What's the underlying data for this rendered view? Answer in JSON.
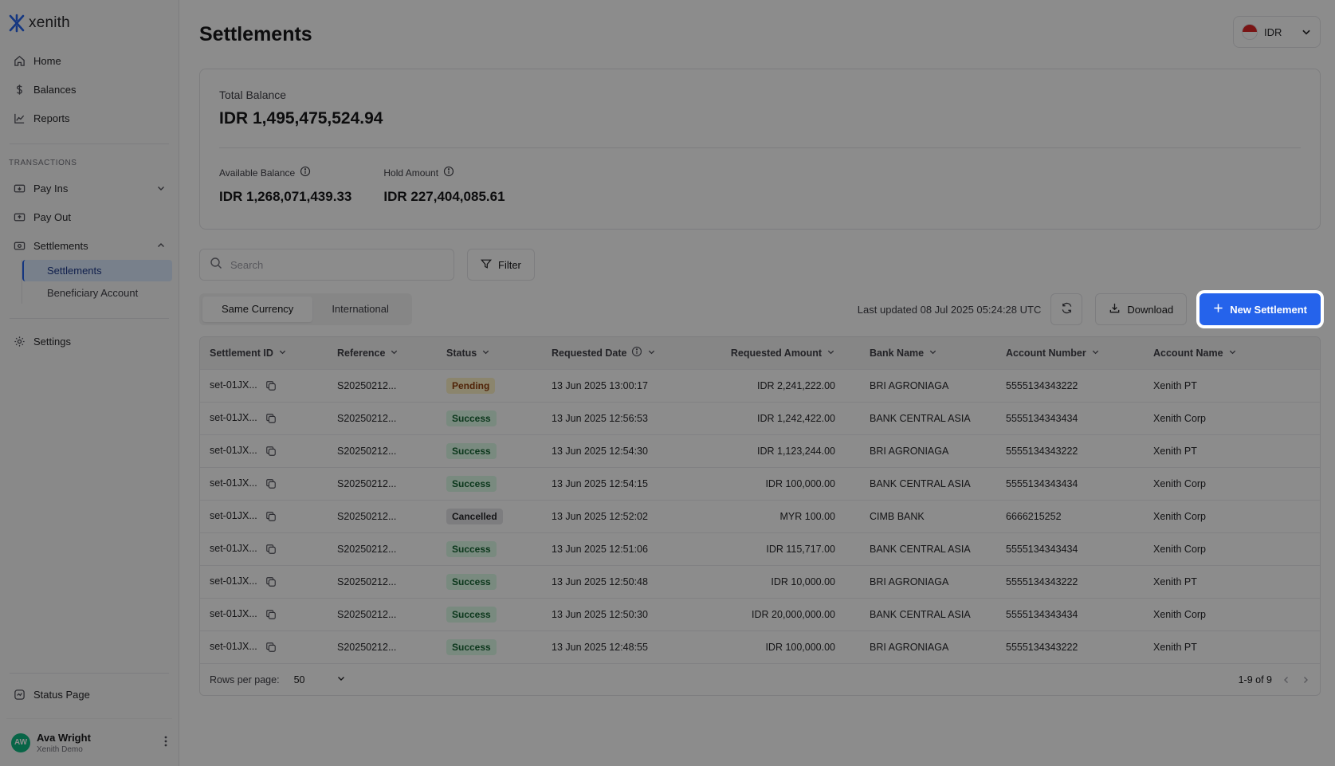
{
  "brand": {
    "name": "xenith"
  },
  "sidebar": {
    "top_items": [
      {
        "label": "Home",
        "icon": "home-icon"
      },
      {
        "label": "Balances",
        "icon": "dollar-icon"
      },
      {
        "label": "Reports",
        "icon": "chart-icon"
      }
    ],
    "section_label": "TRANSACTIONS",
    "transactions": {
      "pay_ins": "Pay Ins",
      "pay_out": "Pay Out",
      "settlements": "Settlements",
      "sub_items": [
        "Settlements",
        "Beneficiary Account"
      ]
    },
    "settings": "Settings",
    "status_page": "Status Page",
    "user": {
      "initials": "AW",
      "name": "Ava Wright",
      "org": "Xenith Demo"
    }
  },
  "header": {
    "title": "Settlements",
    "currency": "IDR"
  },
  "balances": {
    "total_label": "Total Balance",
    "total_value": "IDR 1,495,475,524.94",
    "available_label": "Available Balance",
    "available_value": "IDR 1,268,071,439.33",
    "hold_label": "Hold Amount",
    "hold_value": "IDR 227,404,085.61"
  },
  "toolbar": {
    "search_placeholder": "Search",
    "filter_label": "Filter",
    "tabs": [
      "Same Currency",
      "International"
    ],
    "last_updated": "Last updated 08 Jul 2025 05:24:28 UTC",
    "download_label": "Download",
    "new_settlement_label": "New Settlement"
  },
  "table": {
    "headers": {
      "settlement_id": "Settlement ID",
      "reference": "Reference",
      "status": "Status",
      "requested_date": "Requested Date",
      "requested_amount": "Requested Amount",
      "bank_name": "Bank Name",
      "account_number": "Account Number",
      "account_name": "Account Name"
    },
    "rows": [
      {
        "id": "set-01JX...",
        "ref": "S20250212...",
        "status": "Pending",
        "date": "13 Jun 2025 13:00:17",
        "amount": "IDR 2,241,222.00",
        "bank": "BRI AGRONIAGA",
        "acct_no": "5555134343222",
        "acct_name": "Xenith PT"
      },
      {
        "id": "set-01JX...",
        "ref": "S20250212...",
        "status": "Success",
        "date": "13 Jun 2025 12:56:53",
        "amount": "IDR 1,242,422.00",
        "bank": "BANK CENTRAL ASIA",
        "acct_no": "5555134343434",
        "acct_name": "Xenith Corp"
      },
      {
        "id": "set-01JX...",
        "ref": "S20250212...",
        "status": "Success",
        "date": "13 Jun 2025 12:54:30",
        "amount": "IDR 1,123,244.00",
        "bank": "BRI AGRONIAGA",
        "acct_no": "5555134343222",
        "acct_name": "Xenith PT"
      },
      {
        "id": "set-01JX...",
        "ref": "S20250212...",
        "status": "Success",
        "date": "13 Jun 2025 12:54:15",
        "amount": "IDR 100,000.00",
        "bank": "BANK CENTRAL ASIA",
        "acct_no": "5555134343434",
        "acct_name": "Xenith Corp"
      },
      {
        "id": "set-01JX...",
        "ref": "S20250212...",
        "status": "Cancelled",
        "date": "13 Jun 2025 12:52:02",
        "amount": "MYR 100.00",
        "bank": "CIMB BANK",
        "acct_no": "6666215252",
        "acct_name": "Xenith Corp"
      },
      {
        "id": "set-01JX...",
        "ref": "S20250212...",
        "status": "Success",
        "date": "13 Jun 2025 12:51:06",
        "amount": "IDR 115,717.00",
        "bank": "BANK CENTRAL ASIA",
        "acct_no": "5555134343434",
        "acct_name": "Xenith Corp"
      },
      {
        "id": "set-01JX...",
        "ref": "S20250212...",
        "status": "Success",
        "date": "13 Jun 2025 12:50:48",
        "amount": "IDR 10,000.00",
        "bank": "BRI AGRONIAGA",
        "acct_no": "5555134343222",
        "acct_name": "Xenith PT"
      },
      {
        "id": "set-01JX...",
        "ref": "S20250212...",
        "status": "Success",
        "date": "13 Jun 2025 12:50:30",
        "amount": "IDR 20,000,000.00",
        "bank": "BANK CENTRAL ASIA",
        "acct_no": "5555134343434",
        "acct_name": "Xenith Corp"
      },
      {
        "id": "set-01JX...",
        "ref": "S20250212...",
        "status": "Success",
        "date": "13 Jun 2025 12:48:55",
        "amount": "IDR 100,000.00",
        "bank": "BRI AGRONIAGA",
        "acct_no": "5555134343222",
        "acct_name": "Xenith PT"
      }
    ],
    "footer": {
      "rows_per_page_label": "Rows per page:",
      "rows_per_page_value": "50",
      "range": "1-9 of 9"
    }
  },
  "colors": {
    "accent": "#2563eb",
    "success_bg": "#dcfce7",
    "pending_bg": "#fef3c7",
    "cancelled_bg": "#e4e4e7",
    "avatar": "#10b981"
  }
}
